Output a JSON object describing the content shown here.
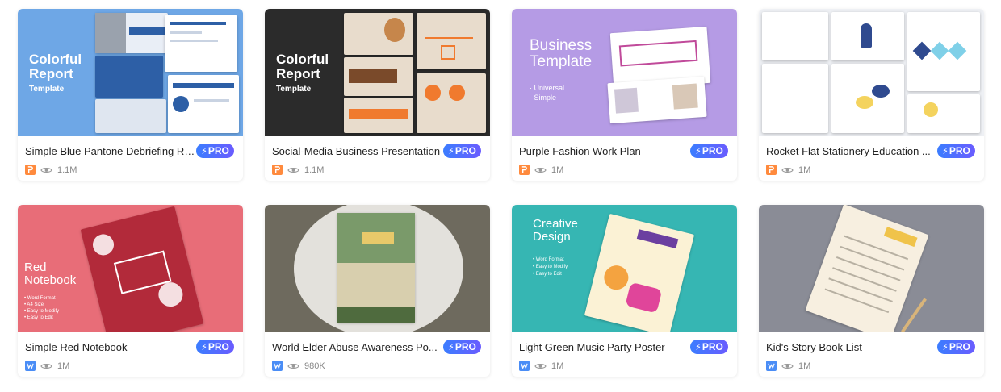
{
  "cards": [
    {
      "title": "Simple Blue Pantone Debriefing Report",
      "pro": "PRO",
      "type": "ppt",
      "views": "1.1M",
      "thumb": {
        "style": "blue",
        "heading": "Colorful Report",
        "sub": "Template"
      }
    },
    {
      "title": "Social-Media Business Presentation",
      "pro": "PRO",
      "type": "ppt",
      "views": "1.1M",
      "thumb": {
        "style": "dark",
        "heading": "Colorful Report",
        "sub": "Template"
      }
    },
    {
      "title": "Purple Fashion Work Plan",
      "pro": "PRO",
      "type": "ppt",
      "views": "1M",
      "thumb": {
        "style": "purple",
        "heading": "Business Template",
        "sub": "· Universal\n· Simple"
      }
    },
    {
      "title": "Rocket Flat Stationery Education ...",
      "pro": "PRO",
      "type": "ppt",
      "views": "1M",
      "thumb": {
        "style": "grey",
        "heading": "",
        "sub": ""
      }
    },
    {
      "title": "Simple Red Notebook",
      "pro": "PRO",
      "type": "word",
      "views": "1M",
      "thumb": {
        "style": "red",
        "heading": "Red Notebook",
        "sub": "• Word Format\n• A4 Size\n• Easy to Modify\n• Easy to Edit"
      }
    },
    {
      "title": "World Elder Abuse Awareness Po...",
      "pro": "PRO",
      "type": "word",
      "views": "980K",
      "thumb": {
        "style": "olive",
        "heading": "",
        "sub": ""
      }
    },
    {
      "title": "Light Green Music Party Poster",
      "pro": "PRO",
      "type": "word",
      "views": "1M",
      "thumb": {
        "style": "teal",
        "heading": "Creative Design",
        "sub": "• Word Format\n• Easy to Modify\n• Easy to Edit"
      }
    },
    {
      "title": "Kid's Story Book List",
      "pro": "PRO",
      "type": "word",
      "views": "1M",
      "thumb": {
        "style": "slate",
        "heading": "",
        "sub": ""
      }
    }
  ],
  "colors": {
    "pro_start": "#3b7dff",
    "pro_end": "#6a5cff",
    "ppt": "#ff8a3d",
    "word": "#4a8df6"
  },
  "icons": {
    "ppt": "ppt-file-icon",
    "word": "word-file-icon",
    "views": "eye-icon",
    "pro": "lightning-icon"
  }
}
